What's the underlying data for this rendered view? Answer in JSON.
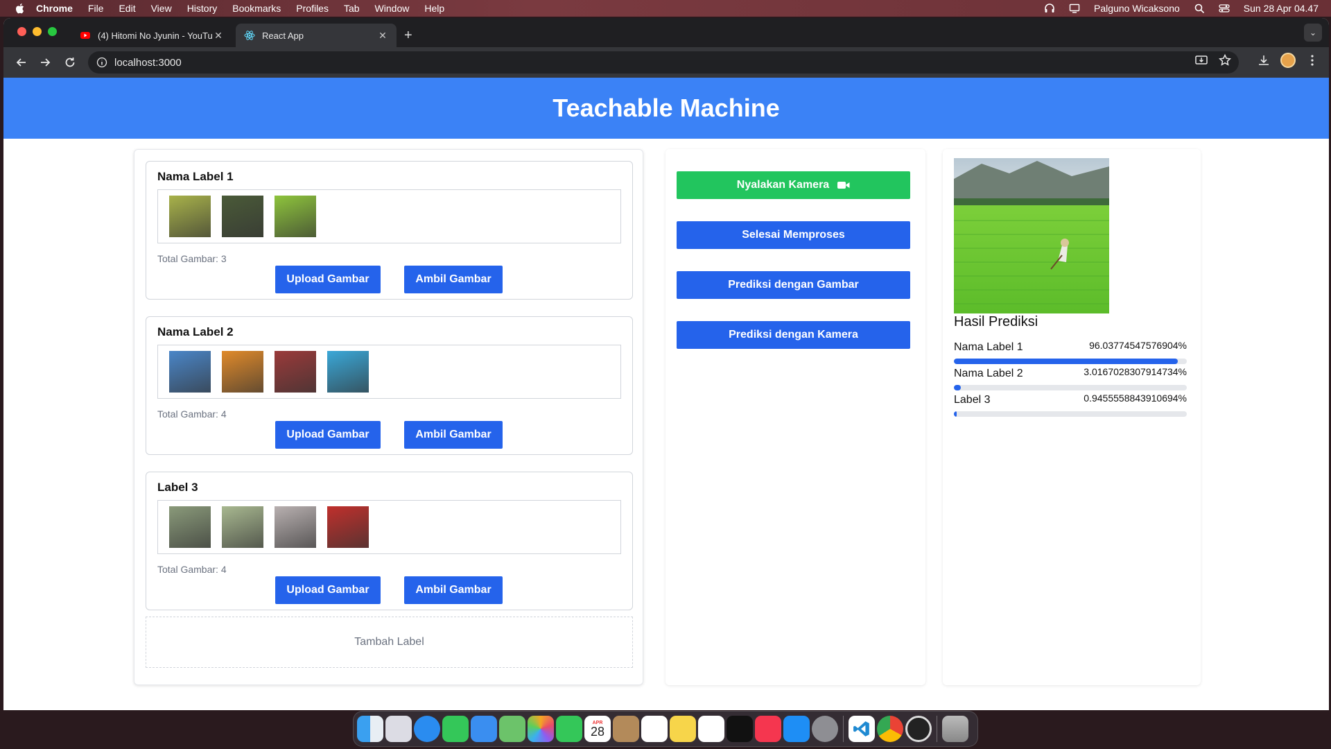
{
  "menubar": {
    "app_name": "Chrome",
    "items": [
      "File",
      "Edit",
      "View",
      "History",
      "Bookmarks",
      "Profiles",
      "Tab",
      "Window",
      "Help"
    ],
    "user": "Palguno Wicaksono",
    "datetime": "Sun 28 Apr  04.47"
  },
  "browser": {
    "tabs": [
      {
        "title": "(4) Hitomi No Jyunin - YouTube",
        "favicon": "youtube-icon"
      },
      {
        "title": "React App",
        "favicon": "react-icon",
        "active": true
      }
    ],
    "url": "localhost:3000"
  },
  "app": {
    "title": "Teachable Machine",
    "labels": [
      {
        "name": "Nama Label 1",
        "total": "Total Gambar: 3",
        "thumb_colors": [
          "#a8b24a",
          "#4a5a38",
          "#8ec43c"
        ]
      },
      {
        "name": "Nama Label 2",
        "total": "Total Gambar: 4",
        "thumb_colors": [
          "#4a86c8",
          "#e08a2a",
          "#9a3a3a",
          "#3aa8d8"
        ]
      },
      {
        "name": "Label 3",
        "total": "Total Gambar: 4",
        "thumb_colors": [
          "#8a9a7a",
          "#a8b890",
          "#b8b0b0",
          "#c0302c"
        ]
      }
    ],
    "upload_label": "Upload Gambar",
    "take_label": "Ambil Gambar",
    "add_label": "Tambah Label",
    "actions": {
      "camera_on": "Nyalakan Kamera",
      "finish": "Selesai Memproses",
      "predict_image": "Prediksi dengan Gambar",
      "predict_camera": "Prediksi dengan Kamera"
    },
    "result_title": "Hasil Prediksi",
    "predictions": [
      {
        "label": "Nama Label 1",
        "value": "96.03774547576904%",
        "fraction": 0.9604
      },
      {
        "label": "Nama Label 2",
        "value": "3.0167028307914734%",
        "fraction": 0.0302
      },
      {
        "label": "Label 3",
        "value": "0.9455558843910694%",
        "fraction": 0.0095
      }
    ]
  },
  "colors": {
    "header_blue": "#3b82f6",
    "button_blue": "#2563eb",
    "button_green": "#22c55e"
  },
  "dock": {
    "calendar_day": "28",
    "calendar_month": "APR",
    "apps": [
      "finder-icon",
      "launchpad-icon",
      "safari-icon",
      "messages-icon",
      "mail-icon",
      "maps-icon",
      "photos-icon",
      "facetime-icon",
      "calendar-icon",
      "contacts-icon",
      "reminders-icon",
      "notes-icon",
      "freeform-icon",
      "tv-icon",
      "music-icon",
      "appstore-icon",
      "settings-icon",
      "vscode-icon",
      "chrome-icon",
      "obs-icon",
      "trash-icon"
    ]
  }
}
